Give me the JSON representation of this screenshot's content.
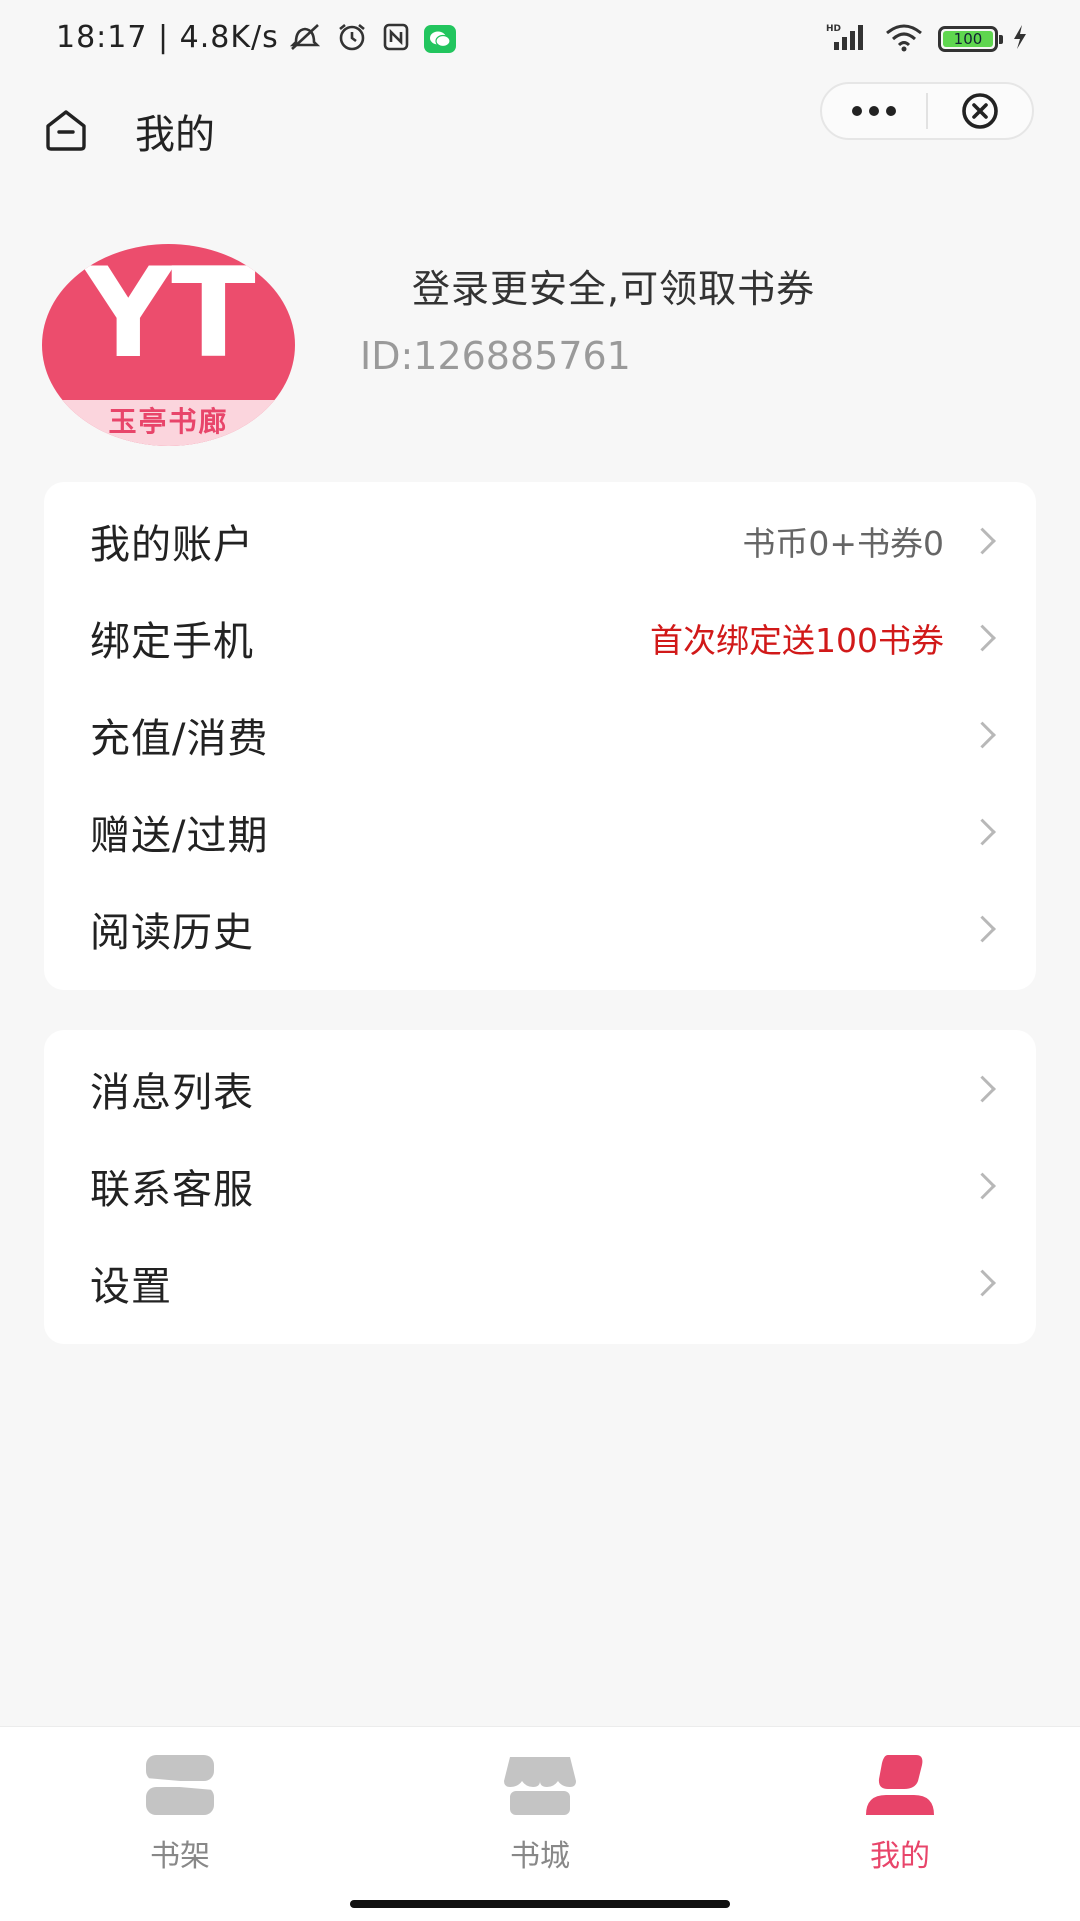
{
  "status_bar": {
    "time": "18:17 | 4.8K/s",
    "battery": "100"
  },
  "nav": {
    "title": "我的"
  },
  "profile": {
    "avatar_text": "YT",
    "avatar_brand": "玉亭书廊",
    "login_tip": "登录更安全,可领取书券",
    "user_id": "ID:126885761"
  },
  "menu_group_1": [
    {
      "label": "我的账户",
      "value": "书币0+书券0"
    },
    {
      "label": "绑定手机",
      "value": "首次绑定送100书券"
    },
    {
      "label": "充值/消费",
      "value": ""
    },
    {
      "label": "赠送/过期",
      "value": ""
    },
    {
      "label": "阅读历史",
      "value": ""
    }
  ],
  "menu_group_2": [
    {
      "label": "消息列表"
    },
    {
      "label": "联系客服"
    },
    {
      "label": "设置"
    }
  ],
  "tabs": [
    {
      "label": "书架",
      "icon": "bookshelf-icon"
    },
    {
      "label": "书城",
      "icon": "bookstore-icon"
    },
    {
      "label": "我的",
      "icon": "profile-icon"
    }
  ],
  "colors": {
    "accent": "#e8456a",
    "promo_red": "#d11919",
    "background": "#f7f7f7"
  }
}
